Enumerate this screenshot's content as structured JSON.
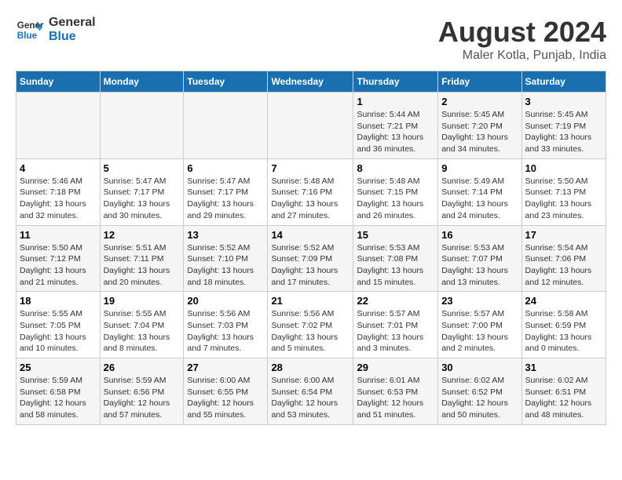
{
  "header": {
    "logo_line1": "General",
    "logo_line2": "Blue",
    "title": "August 2024",
    "subtitle": "Maler Kotla, Punjab, India"
  },
  "weekdays": [
    "Sunday",
    "Monday",
    "Tuesday",
    "Wednesday",
    "Thursday",
    "Friday",
    "Saturday"
  ],
  "weeks": [
    [
      {
        "day": "",
        "info": ""
      },
      {
        "day": "",
        "info": ""
      },
      {
        "day": "",
        "info": ""
      },
      {
        "day": "",
        "info": ""
      },
      {
        "day": "1",
        "info": "Sunrise: 5:44 AM\nSunset: 7:21 PM\nDaylight: 13 hours\nand 36 minutes."
      },
      {
        "day": "2",
        "info": "Sunrise: 5:45 AM\nSunset: 7:20 PM\nDaylight: 13 hours\nand 34 minutes."
      },
      {
        "day": "3",
        "info": "Sunrise: 5:45 AM\nSunset: 7:19 PM\nDaylight: 13 hours\nand 33 minutes."
      }
    ],
    [
      {
        "day": "4",
        "info": "Sunrise: 5:46 AM\nSunset: 7:18 PM\nDaylight: 13 hours\nand 32 minutes."
      },
      {
        "day": "5",
        "info": "Sunrise: 5:47 AM\nSunset: 7:17 PM\nDaylight: 13 hours\nand 30 minutes."
      },
      {
        "day": "6",
        "info": "Sunrise: 5:47 AM\nSunset: 7:17 PM\nDaylight: 13 hours\nand 29 minutes."
      },
      {
        "day": "7",
        "info": "Sunrise: 5:48 AM\nSunset: 7:16 PM\nDaylight: 13 hours\nand 27 minutes."
      },
      {
        "day": "8",
        "info": "Sunrise: 5:48 AM\nSunset: 7:15 PM\nDaylight: 13 hours\nand 26 minutes."
      },
      {
        "day": "9",
        "info": "Sunrise: 5:49 AM\nSunset: 7:14 PM\nDaylight: 13 hours\nand 24 minutes."
      },
      {
        "day": "10",
        "info": "Sunrise: 5:50 AM\nSunset: 7:13 PM\nDaylight: 13 hours\nand 23 minutes."
      }
    ],
    [
      {
        "day": "11",
        "info": "Sunrise: 5:50 AM\nSunset: 7:12 PM\nDaylight: 13 hours\nand 21 minutes."
      },
      {
        "day": "12",
        "info": "Sunrise: 5:51 AM\nSunset: 7:11 PM\nDaylight: 13 hours\nand 20 minutes."
      },
      {
        "day": "13",
        "info": "Sunrise: 5:52 AM\nSunset: 7:10 PM\nDaylight: 13 hours\nand 18 minutes."
      },
      {
        "day": "14",
        "info": "Sunrise: 5:52 AM\nSunset: 7:09 PM\nDaylight: 13 hours\nand 17 minutes."
      },
      {
        "day": "15",
        "info": "Sunrise: 5:53 AM\nSunset: 7:08 PM\nDaylight: 13 hours\nand 15 minutes."
      },
      {
        "day": "16",
        "info": "Sunrise: 5:53 AM\nSunset: 7:07 PM\nDaylight: 13 hours\nand 13 minutes."
      },
      {
        "day": "17",
        "info": "Sunrise: 5:54 AM\nSunset: 7:06 PM\nDaylight: 13 hours\nand 12 minutes."
      }
    ],
    [
      {
        "day": "18",
        "info": "Sunrise: 5:55 AM\nSunset: 7:05 PM\nDaylight: 13 hours\nand 10 minutes."
      },
      {
        "day": "19",
        "info": "Sunrise: 5:55 AM\nSunset: 7:04 PM\nDaylight: 13 hours\nand 8 minutes."
      },
      {
        "day": "20",
        "info": "Sunrise: 5:56 AM\nSunset: 7:03 PM\nDaylight: 13 hours\nand 7 minutes."
      },
      {
        "day": "21",
        "info": "Sunrise: 5:56 AM\nSunset: 7:02 PM\nDaylight: 13 hours\nand 5 minutes."
      },
      {
        "day": "22",
        "info": "Sunrise: 5:57 AM\nSunset: 7:01 PM\nDaylight: 13 hours\nand 3 minutes."
      },
      {
        "day": "23",
        "info": "Sunrise: 5:57 AM\nSunset: 7:00 PM\nDaylight: 13 hours\nand 2 minutes."
      },
      {
        "day": "24",
        "info": "Sunrise: 5:58 AM\nSunset: 6:59 PM\nDaylight: 13 hours\nand 0 minutes."
      }
    ],
    [
      {
        "day": "25",
        "info": "Sunrise: 5:59 AM\nSunset: 6:58 PM\nDaylight: 12 hours\nand 58 minutes."
      },
      {
        "day": "26",
        "info": "Sunrise: 5:59 AM\nSunset: 6:56 PM\nDaylight: 12 hours\nand 57 minutes."
      },
      {
        "day": "27",
        "info": "Sunrise: 6:00 AM\nSunset: 6:55 PM\nDaylight: 12 hours\nand 55 minutes."
      },
      {
        "day": "28",
        "info": "Sunrise: 6:00 AM\nSunset: 6:54 PM\nDaylight: 12 hours\nand 53 minutes."
      },
      {
        "day": "29",
        "info": "Sunrise: 6:01 AM\nSunset: 6:53 PM\nDaylight: 12 hours\nand 51 minutes."
      },
      {
        "day": "30",
        "info": "Sunrise: 6:02 AM\nSunset: 6:52 PM\nDaylight: 12 hours\nand 50 minutes."
      },
      {
        "day": "31",
        "info": "Sunrise: 6:02 AM\nSunset: 6:51 PM\nDaylight: 12 hours\nand 48 minutes."
      }
    ]
  ]
}
